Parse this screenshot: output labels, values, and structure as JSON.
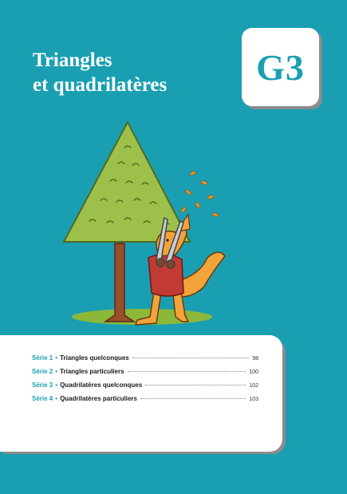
{
  "chapter": {
    "title_line1": "Triangles",
    "title_line2": "et quadrilatères",
    "code": "G3"
  },
  "illustration": {
    "subject": "kangaroo-trimming-triangle-tree",
    "colors": {
      "background": "#1a9fb2",
      "foliage": "#9cc04a",
      "trunk": "#9b4e2c",
      "kangaroo": "#f2a33a",
      "sweater": "#c23a34",
      "ground": "#8cb83a"
    }
  },
  "toc": [
    {
      "serie": "Série 1",
      "title": "Triangles quelconques",
      "page": "98"
    },
    {
      "serie": "Série 2",
      "title": "Triangles particuliers",
      "page": "100"
    },
    {
      "serie": "Série 3",
      "title": "Quadrilatères quelconques",
      "page": "102"
    },
    {
      "serie": "Série 4",
      "title": "Quadrilatères particuliers",
      "page": "103"
    }
  ],
  "bullet": "•"
}
